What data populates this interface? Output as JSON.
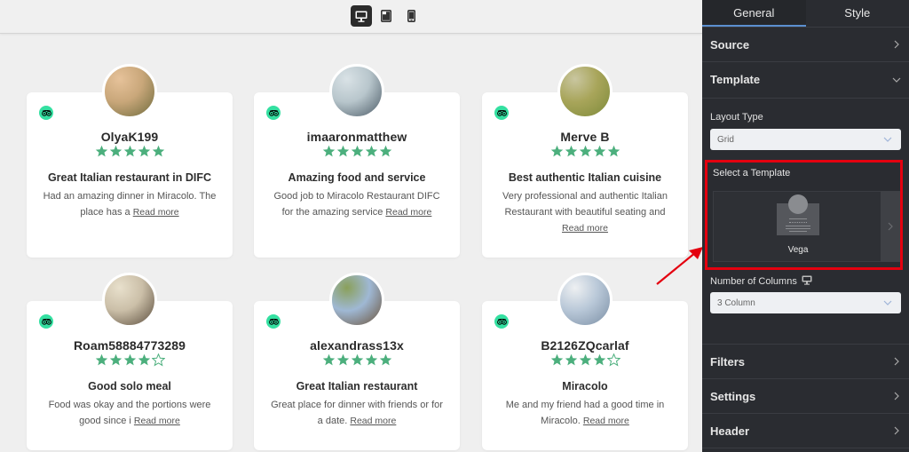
{
  "preview": {
    "device_modes": [
      {
        "name": "desktop",
        "active": true
      },
      {
        "name": "tablet",
        "active": false
      },
      {
        "name": "mobile",
        "active": false
      }
    ],
    "cards": [
      {
        "reviewer": "OlyaK199",
        "rating": 5,
        "title": "Great Italian restaurant in DIFC",
        "text": "Had an amazing dinner in Miracolo. The place has a",
        "read_more": "Read more",
        "avatar_colors": [
          "#c9a77a",
          "#6e6a3c",
          "#e6c29a"
        ]
      },
      {
        "reviewer": "imaaronmatthew",
        "rating": 5,
        "title": "Amazing food and service",
        "text": "Good job to Miracolo Restaurant DIFC for the amazing service",
        "read_more": "Read more",
        "avatar_colors": [
          "#b8c6cc",
          "#4b5a66",
          "#d9e2e6"
        ]
      },
      {
        "reviewer": "Merve B",
        "rating": 5,
        "title": "Best authentic Italian cuisine",
        "text": "Very professional and authentic Italian Restaurant with beautiful seating and",
        "read_more": "Read more",
        "avatar_colors": [
          "#a8a55a",
          "#7d8a3a",
          "#c9c6a0"
        ]
      },
      {
        "reviewer": "Roam58884773289",
        "rating": 4,
        "title": "Good solo meal",
        "text": "Food was okay and the portions were good since i",
        "read_more": "Read more",
        "avatar_colors": [
          "#cbbfa8",
          "#5a4c3c",
          "#e8e0cc"
        ]
      },
      {
        "reviewer": "alexandrass13x",
        "rating": 5,
        "title": "Great Italian restaurant",
        "text": "Great place for dinner with friends or for a date.",
        "read_more": "Read more",
        "avatar_colors": [
          "#9fb8d4",
          "#6a5238",
          "#8aa05a"
        ]
      },
      {
        "reviewer": "B2126ZQcarlaf",
        "rating": 4,
        "title": "Miracolo",
        "text": "Me and my friend had a good time in Miracolo.",
        "read_more": "Read more",
        "avatar_colors": [
          "#b9c8d8",
          "#7a8ea4",
          "#eef0f2"
        ]
      }
    ],
    "star_color": "#4caf7d",
    "badge_color": "#34e0a1"
  },
  "sidebar": {
    "tabs": [
      {
        "label": "General",
        "active": true
      },
      {
        "label": "Style",
        "active": false
      }
    ],
    "sections": {
      "source": "Source",
      "template": "Template",
      "filters": "Filters",
      "settings": "Settings",
      "header": "Header"
    },
    "layout_type": {
      "label": "Layout Type",
      "value": "Grid"
    },
    "select_template": {
      "label": "Select a Template",
      "template_name": "Vega"
    },
    "columns": {
      "label": "Number of Columns",
      "value": "3 Column"
    },
    "highlight_color": "#e4000f",
    "accent_color": "#5b8fd0"
  }
}
